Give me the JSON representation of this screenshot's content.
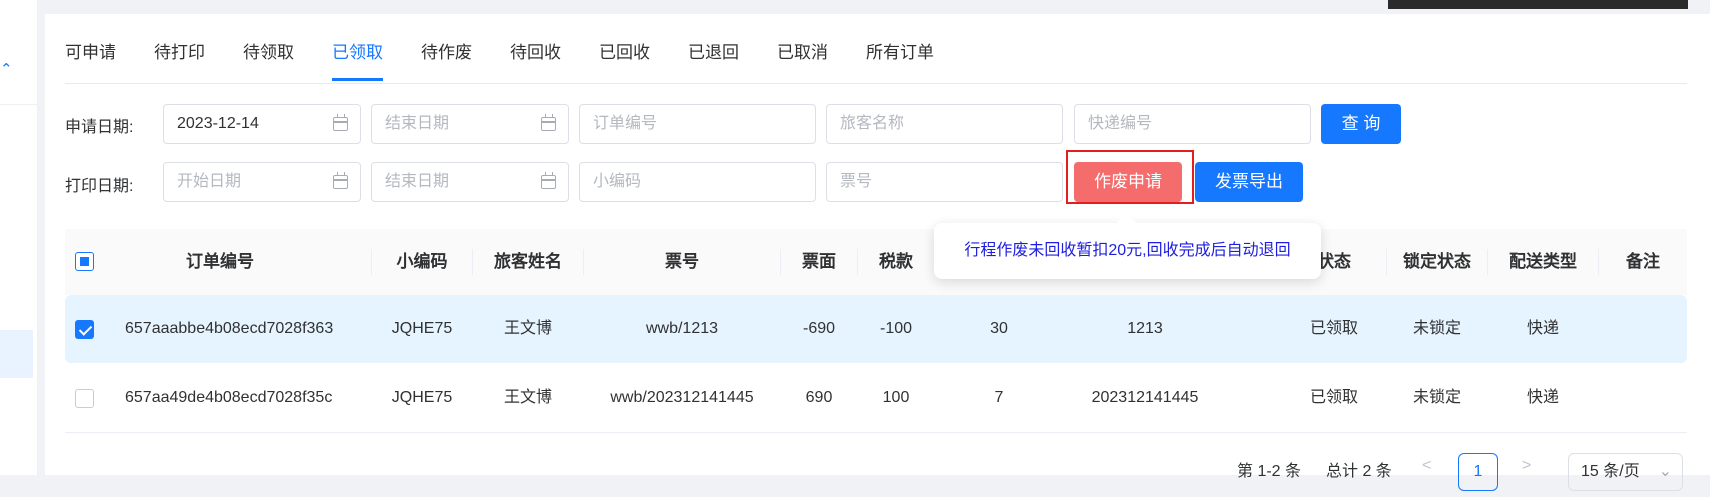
{
  "tabs": [
    "可申请",
    "待打印",
    "待领取",
    "已领取",
    "待作废",
    "待回收",
    "已回收",
    "已退回",
    "已取消",
    "所有订单"
  ],
  "active_tab": "已领取",
  "form": {
    "apply_date_label": "申请日期:",
    "apply_date_start": "2023-12-14",
    "apply_date_end_placeholder": "结束日期",
    "order_no_placeholder": "订单编号",
    "passenger_placeholder": "旅客名称",
    "express_no_placeholder": "快递编号",
    "query_button": "查 询",
    "print_date_label": "打印日期:",
    "print_date_start_placeholder": "开始日期",
    "print_date_end_placeholder": "结束日期",
    "small_code_placeholder": "小编码",
    "ticket_no_placeholder": "票号",
    "void_apply_button": "作废申请",
    "invoice_export_button": "发票导出"
  },
  "tooltip": "行程作废未回收暂扣20元,回收完成后自动退回",
  "table": {
    "headers": [
      "订单编号",
      "小编码",
      "旅客姓名",
      "票号",
      "票面",
      "税款",
      "状态",
      "锁定状态",
      "配送类型",
      "备注"
    ],
    "rows": [
      {
        "checked": true,
        "order_no": "657aaabbe4b08ecd7028f363",
        "small_code": "JQHE75",
        "passenger": "王文博",
        "ticket_no": "wwb/1213",
        "face": "-690",
        "tax": "-100",
        "c7": "30",
        "c8": "1213",
        "status": "已领取",
        "lock": "未锁定",
        "delivery": "快递",
        "remark": ""
      },
      {
        "checked": false,
        "order_no": "657aa49de4b08ecd7028f35c",
        "small_code": "JQHE75",
        "passenger": "王文博",
        "ticket_no": "wwb/202312141445",
        "face": "690",
        "tax": "100",
        "c7": "7",
        "c8": "202312141445",
        "status": "已领取",
        "lock": "未锁定",
        "delivery": "快递",
        "remark": ""
      }
    ]
  },
  "pager": {
    "range": "第 1-2 条",
    "total": "总计 2 条",
    "prev": "<",
    "current_page": "1",
    "next": ">",
    "page_size": "15 条/页"
  },
  "colors": {
    "primary": "#1677ff",
    "danger": "#f56c6c",
    "highlight_box": "#e02020",
    "tooltip_text": "#1e1ee0",
    "selected_row": "#e6f4ff"
  }
}
